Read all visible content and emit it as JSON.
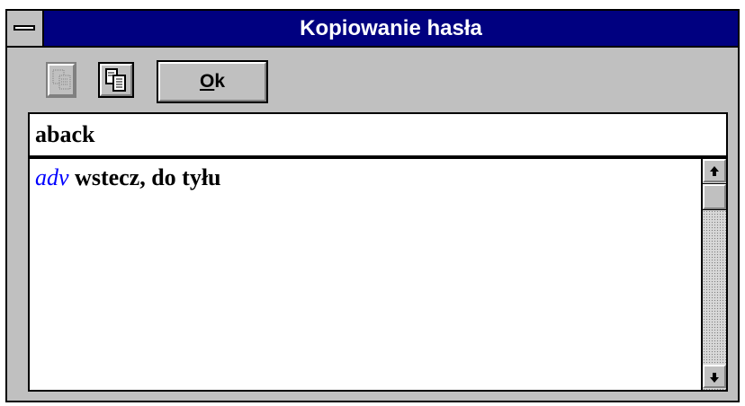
{
  "window": {
    "title": "Kopiowanie hasła"
  },
  "toolbar": {
    "copy_disabled_icon": "copy-disabled-icon",
    "copy_icon": "copy-icon",
    "ok_label_underlined": "O",
    "ok_label_rest": "k"
  },
  "entry": {
    "headword": "aback"
  },
  "content": {
    "part_of_speech": "adv",
    "definition": " wstecz, do tyłu"
  },
  "colors": {
    "titlebar": "#000080",
    "window_bg": "#c0c0c0",
    "part_of_speech": "#0000ff"
  }
}
